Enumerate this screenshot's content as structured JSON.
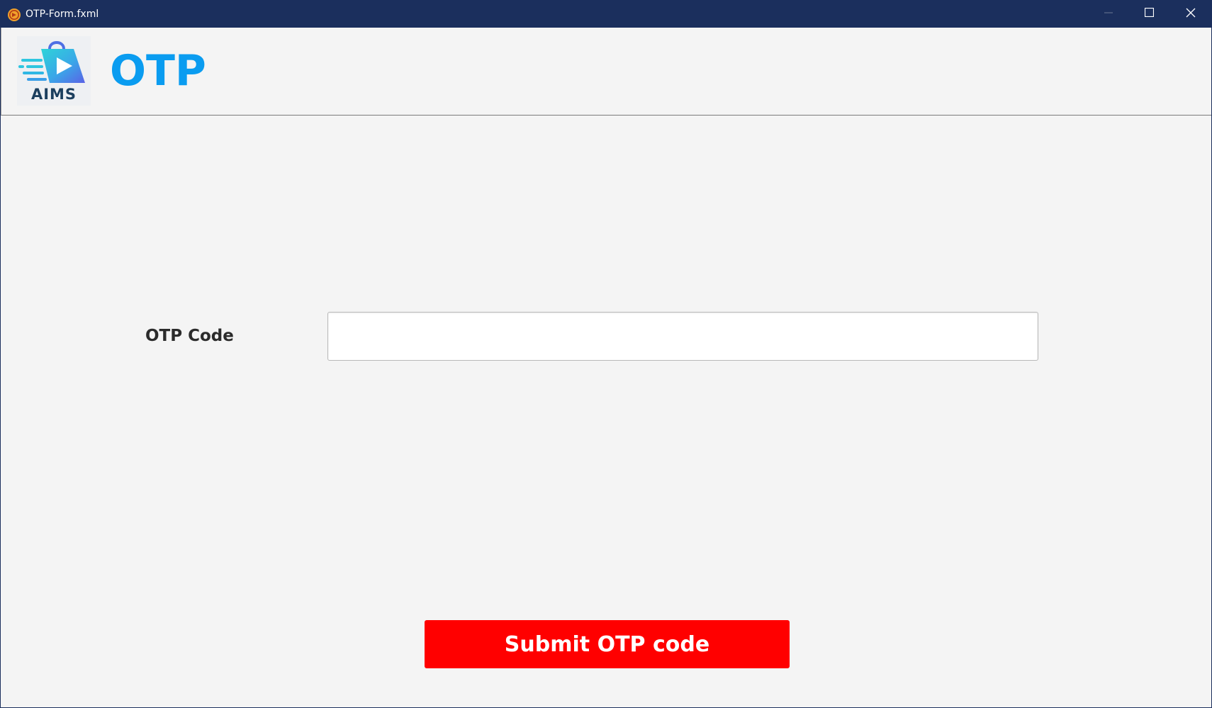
{
  "window": {
    "title": "OTP-Form.fxml",
    "app_icon": "java-coffee-icon",
    "controls": {
      "minimize_icon": "minimize-icon",
      "maximize_icon": "maximize-icon",
      "close_icon": "close-icon"
    },
    "titlebar_color": "#1b2f5d"
  },
  "header": {
    "logo_text": "AIMS",
    "logo_icon": "shopping-bag-play-icon",
    "title": "OTP",
    "title_color": "#0a9cf0"
  },
  "form": {
    "otp_label": "OTP Code",
    "otp_value": "",
    "otp_placeholder": ""
  },
  "actions": {
    "submit_label": "Submit OTP code",
    "submit_color": "#ff0000"
  }
}
